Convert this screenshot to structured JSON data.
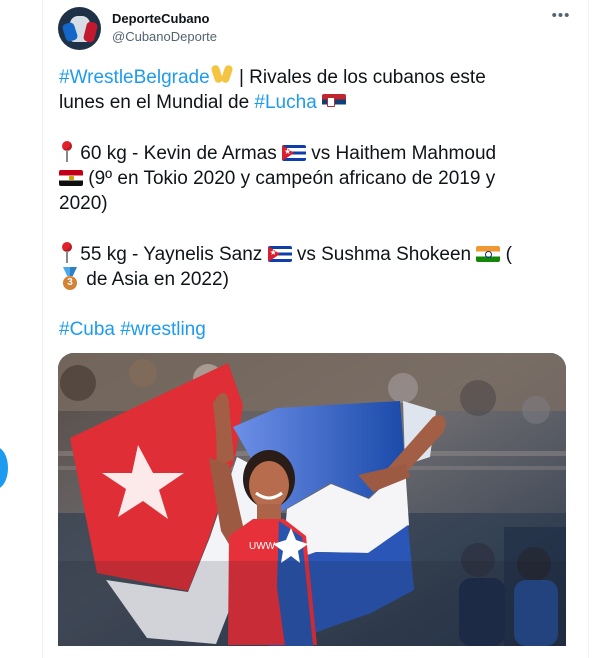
{
  "account": {
    "display_name": "DeporteCubano",
    "handle": "@CubanoDeporte"
  },
  "menu": {
    "more_label": "•••"
  },
  "post": {
    "line1_hashtag": "#WrestleBelgrade",
    "line1_text": " | Rivales de los cubanos este",
    "line2_text": "lunes en el Mundial de ",
    "line2_hashtag": "#Lucha",
    "entry1_a": " 60 kg - Kevin de Armas ",
    "entry1_b": " vs Haithem Mahmoud",
    "entry1_c": " (9º en Tokio 2020 y campeón africano de 2019 y",
    "entry1_d": "2020)",
    "entry2_a": " 55 kg - Yaynelis Sanz ",
    "entry2_b": " vs Sushma Shokeen ",
    "entry2_c": " (",
    "entry2_d": " de Asia en 2022)",
    "tags": [
      "#Cuba",
      "#wrestling"
    ]
  },
  "icons": {
    "wrestlers": "people-wrestling-icon",
    "pin": "round-pushpin-icon",
    "cuba": "cuba-flag-icon",
    "egypt": "egypt-flag-icon",
    "serbia": "serbia-flag-icon",
    "india": "india-flag-icon",
    "medal": "third-place-medal-icon",
    "more": "more-icon"
  },
  "colors": {
    "link": "#1d9bf0",
    "text": "#0f1419",
    "muted": "#536471",
    "cuba_blue": "#0e3fa8",
    "cuba_red": "#d71f2f"
  }
}
